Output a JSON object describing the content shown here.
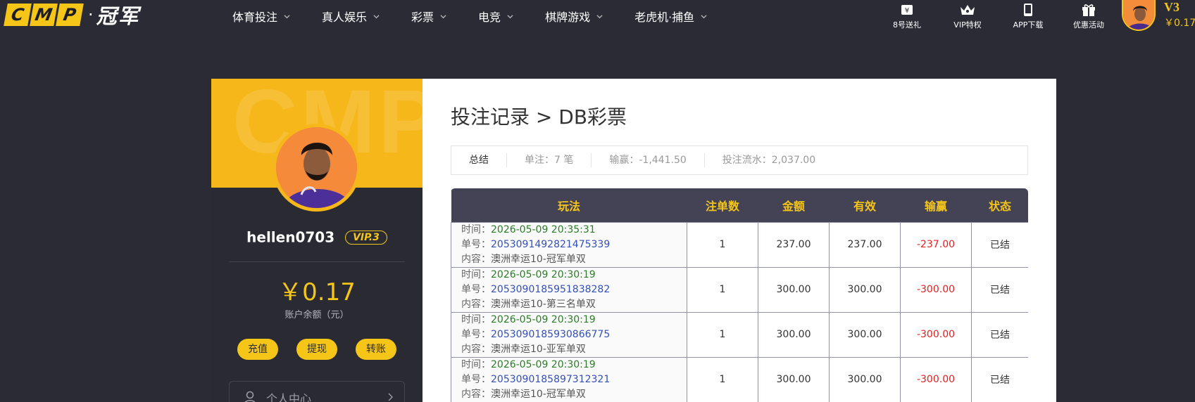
{
  "header": {
    "logo": {
      "letters": [
        "C",
        "M",
        "P"
      ],
      "dot": "·",
      "cn": "冠军"
    },
    "nav": [
      {
        "label": "体育投注"
      },
      {
        "label": "真人娱乐"
      },
      {
        "label": "彩票"
      },
      {
        "label": "电竞"
      },
      {
        "label": "棋牌游戏"
      },
      {
        "label": "老虎机·捕鱼"
      }
    ],
    "tools": [
      {
        "label": "8号送礼",
        "icon": "ticket-icon"
      },
      {
        "label": "VIP特权",
        "icon": "crown-icon"
      },
      {
        "label": "APP下载",
        "icon": "phone-icon"
      },
      {
        "label": "优惠活动",
        "icon": "gift-icon"
      }
    ],
    "vip_level": "V3",
    "balance": "￥0.17"
  },
  "profile": {
    "watermark": "CMP",
    "username": "hellen0703",
    "vip_badge": "VIP.3",
    "balance": "￥0.17",
    "balance_label": "账户余额（元）",
    "actions": [
      "充值",
      "提现",
      "转账"
    ],
    "menu_item": "个人中心"
  },
  "main": {
    "title": "投注记录 > DB彩票",
    "summary": {
      "title": "总结",
      "bets_label": "单注：",
      "bets_value": "7 笔",
      "winloss_label": "输赢：",
      "winloss_value": "-1,441.50",
      "turnover_label": "投注流水：",
      "turnover_value": "2,037.00"
    },
    "table": {
      "headers": [
        "玩法",
        "注单数",
        "金额",
        "有效",
        "输赢",
        "状态"
      ],
      "time_label": "时间：",
      "no_label": "单号：",
      "content_label": "内容：",
      "rows": [
        {
          "time": "2026-05-09 20:35:31",
          "no": "2053091492821475339",
          "content": "澳洲幸运10-冠军单双",
          "count": "1",
          "amount": "237.00",
          "valid": "237.00",
          "winloss": "-237.00",
          "status": "已结"
        },
        {
          "time": "2026-05-09 20:30:19",
          "no": "2053090185951838282",
          "content": "澳洲幸运10-第三名单双",
          "count": "1",
          "amount": "300.00",
          "valid": "300.00",
          "winloss": "-300.00",
          "status": "已结"
        },
        {
          "time": "2026-05-09 20:30:19",
          "no": "2053090185930866775",
          "content": "澳洲幸运10-亚军单双",
          "count": "1",
          "amount": "300.00",
          "valid": "300.00",
          "winloss": "-300.00",
          "status": "已结"
        },
        {
          "time": "2026-05-09 20:30:19",
          "no": "2053090185897312321",
          "content": "澳洲幸运10-冠军单双",
          "count": "1",
          "amount": "300.00",
          "valid": "300.00",
          "winloss": "-300.00",
          "status": "已结"
        }
      ]
    }
  },
  "colors": {
    "accent": "#f5c518",
    "background": "#2b2b36",
    "table_header": "#444355",
    "loss": "#e02020",
    "order_no": "#3450b8",
    "time": "#2a7d26"
  }
}
